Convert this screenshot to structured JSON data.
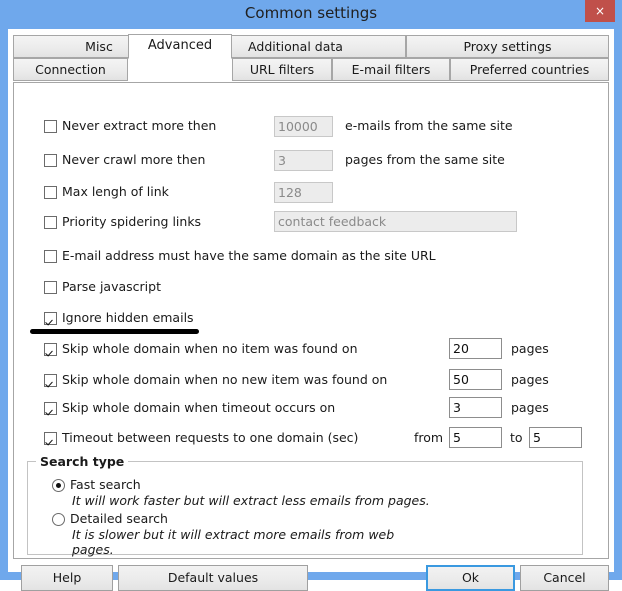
{
  "window": {
    "title": "Common settings",
    "close_label": "×",
    "accent_color": "#6fa8ec",
    "close_color": "#c0504a",
    "focus_color": "#3a99e0"
  },
  "tabs": {
    "row1": [
      {
        "label": "Misc",
        "selected": false
      },
      {
        "label": "Additional data",
        "selected": false
      },
      {
        "label": "Proxy settings",
        "selected": false
      }
    ],
    "row2": [
      {
        "label": "Connection",
        "selected": false
      },
      {
        "label": "Advanced",
        "selected": true
      },
      {
        "label": "URL filters",
        "selected": false
      },
      {
        "label": "E-mail filters",
        "selected": false
      },
      {
        "label": "Preferred countries",
        "selected": false
      }
    ]
  },
  "options": [
    {
      "label": "Never extract more then",
      "checked": false,
      "value": "10000",
      "enabled": false,
      "unit": "e-mails from the same site"
    },
    {
      "label": "Never crawl more then",
      "checked": false,
      "value": "3",
      "enabled": false,
      "unit": "pages from the same site"
    },
    {
      "label": "Max lengh of link",
      "checked": false,
      "value": "128",
      "enabled": false,
      "unit": ""
    },
    {
      "label": "Priority spidering links",
      "checked": false,
      "value": "contact feedback",
      "enabled": false,
      "unit": ""
    },
    {
      "label": "E-mail address must have the same domain as the site URL",
      "checked": false,
      "value": "",
      "enabled": false,
      "unit": ""
    },
    {
      "label": "Parse javascript",
      "checked": false,
      "value": "",
      "enabled": false,
      "unit": ""
    },
    {
      "label": "Ignore hidden emails",
      "checked": true,
      "value": "",
      "enabled": false,
      "unit": ""
    },
    {
      "label": "Skip whole domain when no item was found on",
      "checked": true,
      "value": "20",
      "enabled": true,
      "unit": "pages"
    },
    {
      "label": "Skip whole domain when no new item was found on",
      "checked": true,
      "value": "50",
      "enabled": true,
      "unit": "pages"
    },
    {
      "label": "Skip whole domain when timeout occurs on",
      "checked": true,
      "value": "3",
      "enabled": true,
      "unit": "pages"
    }
  ],
  "timeout_row": {
    "label": "Timeout between requests to one domain (sec)",
    "checked": true,
    "from_label": "from",
    "from_value": "5",
    "to_label": "to",
    "to_value": "5"
  },
  "search_type": {
    "title": "Search type",
    "options": [
      {
        "label": "Fast search",
        "description": "It will work faster but will extract less emails from pages.",
        "selected": true
      },
      {
        "label": "Detailed search",
        "description": "It is slower but it will extract more emails from web\npages.",
        "selected": false
      }
    ]
  },
  "footer": {
    "help_label": "Help",
    "default_values_label": "Default values",
    "ok_label": "Ok",
    "cancel_label": "Cancel"
  }
}
